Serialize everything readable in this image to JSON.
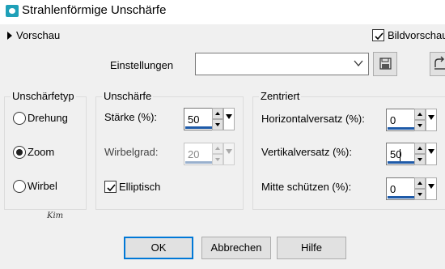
{
  "window": {
    "title": "Strahlenförmige Unschärfe"
  },
  "preview": {
    "label": "Vorschau",
    "bild_label": "Bildvorschau",
    "bild_checked": true
  },
  "settings": {
    "label": "Einstellungen",
    "value": ""
  },
  "blur_type": {
    "title": "Unschärfetyp",
    "options": [
      {
        "label": "Drehung",
        "selected": false
      },
      {
        "label": "Zoom",
        "selected": true
      },
      {
        "label": "Wirbel",
        "selected": false
      }
    ]
  },
  "blur": {
    "title": "Unschärfe",
    "strength_label": "Stärke (%):",
    "strength_value": "50",
    "twist_label": "Wirbelgrad:",
    "twist_value": "20",
    "elliptical_label": "Elliptisch",
    "elliptical_checked": true
  },
  "centered": {
    "title": "Zentriert",
    "h_offset_label": "Horizontalversatz (%):",
    "h_offset_value": "0",
    "v_offset_label": "Vertikalversatz (%):",
    "v_offset_value": "50",
    "protect_label": "Mitte schützen (%):",
    "protect_value": "0"
  },
  "buttons": {
    "ok": "OK",
    "cancel": "Abbrechen",
    "help": "Hilfe"
  },
  "colors": {
    "accent": "#0078d7",
    "spin_underline": "#1e5aa8"
  },
  "signature": "Kim"
}
